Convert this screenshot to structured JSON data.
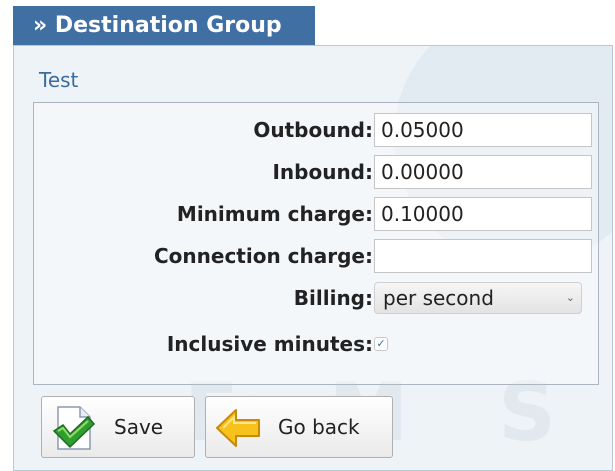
{
  "header": {
    "title": "» Destination Group",
    "color": "#3f6fa3"
  },
  "record": {
    "name": "Test"
  },
  "form": {
    "outbound": {
      "label": "Outbound:",
      "value": "0.05000"
    },
    "inbound": {
      "label": "Inbound:",
      "value": "0.00000"
    },
    "minimum_charge": {
      "label": "Minimum charge:",
      "value": "0.10000"
    },
    "connection_charge": {
      "label": "Connection charge:",
      "value": ""
    },
    "billing": {
      "label": "Billing:",
      "selected": "per second"
    },
    "inclusive_minutes": {
      "label": "Inclusive minutes:",
      "checked": true
    }
  },
  "buttons": {
    "save": {
      "label": "Save",
      "icon": "checkmark-document-icon"
    },
    "back": {
      "label": "Go back",
      "icon": "arrow-left-icon"
    }
  }
}
